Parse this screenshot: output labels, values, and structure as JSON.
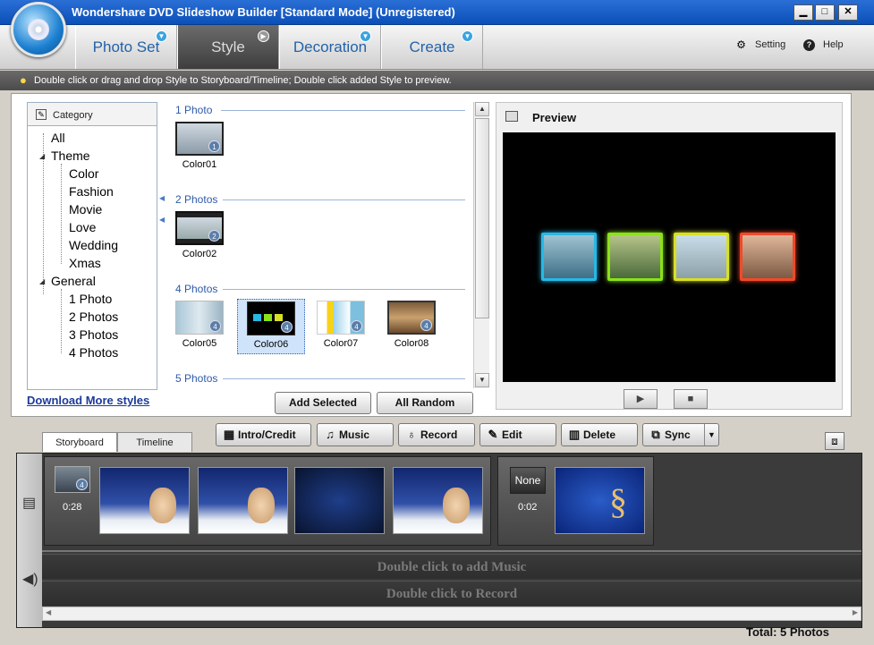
{
  "window": {
    "title": "Wondershare DVD Slideshow Builder [Standard Mode]  (Unregistered)",
    "minimize": "▁",
    "maximize": "□",
    "close": "✕"
  },
  "main_tabs": [
    {
      "label": "Photo Set",
      "icon": "arrow-down-icon"
    },
    {
      "label": "Style",
      "icon": "arrow-right-icon"
    },
    {
      "label": "Decoration",
      "icon": "arrow-down-icon"
    },
    {
      "label": "Create",
      "icon": "arrow-down-icon"
    }
  ],
  "top_links": {
    "setting": "Setting",
    "help": "Help"
  },
  "hint": "Double click or drag and drop Style to Storyboard/Timeline; Double click added Style to preview.",
  "category": {
    "header": "Category",
    "items": [
      "All",
      "Theme",
      "Color",
      "Fashion",
      "Movie",
      "Love",
      "Wedding",
      "Xmas",
      "General",
      "1 Photo",
      "2 Photos",
      "3 Photos",
      "4 Photos"
    ]
  },
  "download_link": "Download More styles",
  "style_groups": [
    {
      "heading": "1 Photo",
      "items": [
        {
          "label": "Color01",
          "badge": "1"
        }
      ]
    },
    {
      "heading": "2 Photos",
      "items": [
        {
          "label": "Color02",
          "badge": "2"
        }
      ]
    },
    {
      "heading": "4 Photos",
      "items": [
        {
          "label": "Color05",
          "badge": "4"
        },
        {
          "label": "Color06",
          "badge": "4"
        },
        {
          "label": "Color07",
          "badge": "4"
        },
        {
          "label": "Color08",
          "badge": "4"
        }
      ]
    },
    {
      "heading": "5 Photos",
      "items": []
    }
  ],
  "buttons": {
    "add_selected": "Add Selected",
    "all_random": "All Random"
  },
  "preview": {
    "heading": "Preview",
    "frame_colors": [
      "#27b8e6",
      "#8be21a",
      "#d8e024",
      "#ef4a2a"
    ],
    "play": "▶",
    "stop": "■"
  },
  "bottom_tabs": {
    "storyboard": "Storyboard",
    "timeline": "Timeline"
  },
  "tools": [
    {
      "label": "Intro/Credit",
      "icon": "film-icon"
    },
    {
      "label": "Music",
      "icon": "music-note-icon"
    },
    {
      "label": "Record",
      "icon": "microphone-icon"
    },
    {
      "label": "Edit",
      "icon": "pencil-icon"
    },
    {
      "label": "Delete",
      "icon": "trash-icon"
    },
    {
      "label": "Sync",
      "icon": "sync-icon"
    }
  ],
  "storyboard": {
    "group1_duration": "0:28",
    "group1_badge": "4",
    "group2_label": "None",
    "group2_duration": "0:02",
    "music_hint": "Double click to add Music",
    "record_hint": "Double click to Record"
  },
  "total": "Total: 5 Photos"
}
